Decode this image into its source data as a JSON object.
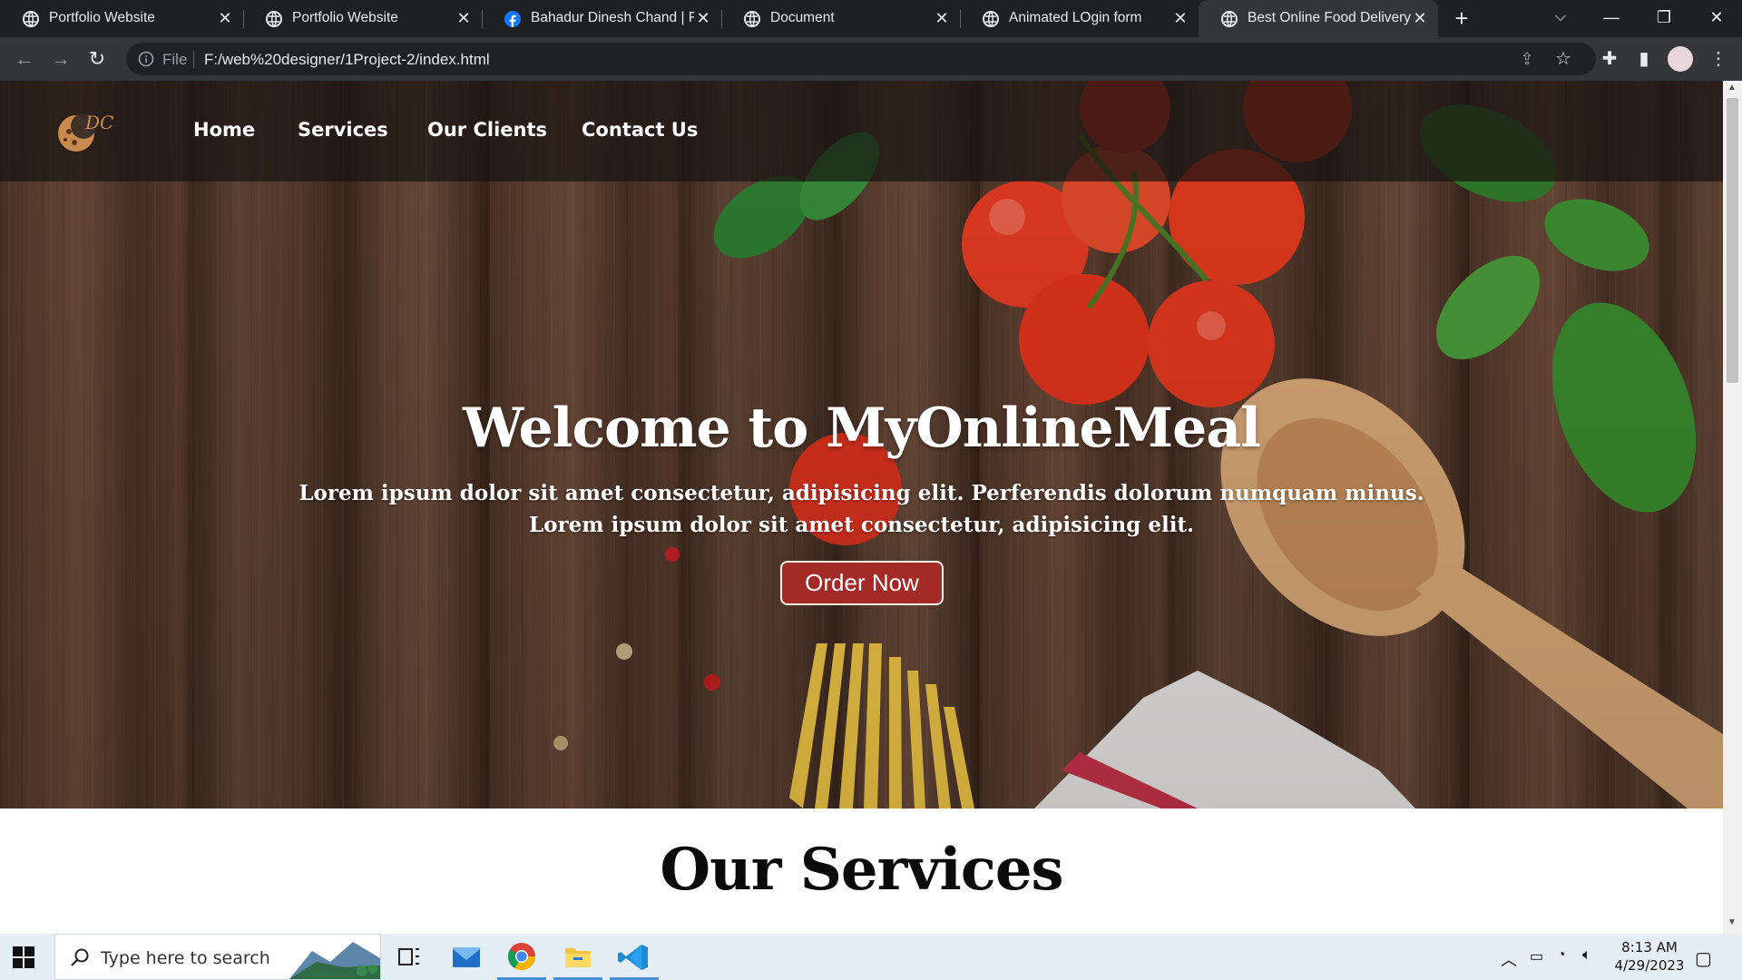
{
  "browser": {
    "tabs": [
      {
        "title": "Portfolio Website",
        "icon": "globe-icon",
        "active": false
      },
      {
        "title": "Portfolio Website",
        "icon": "globe-icon",
        "active": false
      },
      {
        "title": "Bahadur Dinesh Chand | Fac",
        "icon": "facebook-icon",
        "active": false
      },
      {
        "title": "Document",
        "icon": "globe-icon",
        "active": false
      },
      {
        "title": "Animated LOgin form",
        "icon": "globe-icon",
        "active": false
      },
      {
        "title": "Best Online Food Delivery S",
        "icon": "globe-icon",
        "active": true
      }
    ],
    "new_tab_label": "+",
    "address": {
      "scheme_label": "File",
      "url": "F:/web%20designer/1Project-2/index.html"
    }
  },
  "site": {
    "logo_text": "DC",
    "nav": [
      "Home",
      "Services",
      "Our Clients",
      "Contact Us"
    ],
    "hero": {
      "title": "Welcome to MyOnlineMeal",
      "subtitle_line1": "Lorem ipsum dolor sit amet consectetur, adipisicing elit. Perferendis dolorum numquam minus.",
      "subtitle_line2": "Lorem ipsum dolor sit amet consectetur, adipisicing elit.",
      "cta": "Order Now"
    },
    "services_heading": "Our Services"
  },
  "taskbar": {
    "search_placeholder": "Type here to search",
    "time": "8:13 AM",
    "date": "4/29/2023",
    "pinned": [
      "task-view-icon",
      "mail-icon",
      "chrome-icon",
      "file-explorer-icon",
      "vscode-icon"
    ]
  },
  "colors": {
    "cta_bg": "#a32a27",
    "tab_bg": "#1f2022",
    "toolbar_bg": "#35363a"
  }
}
